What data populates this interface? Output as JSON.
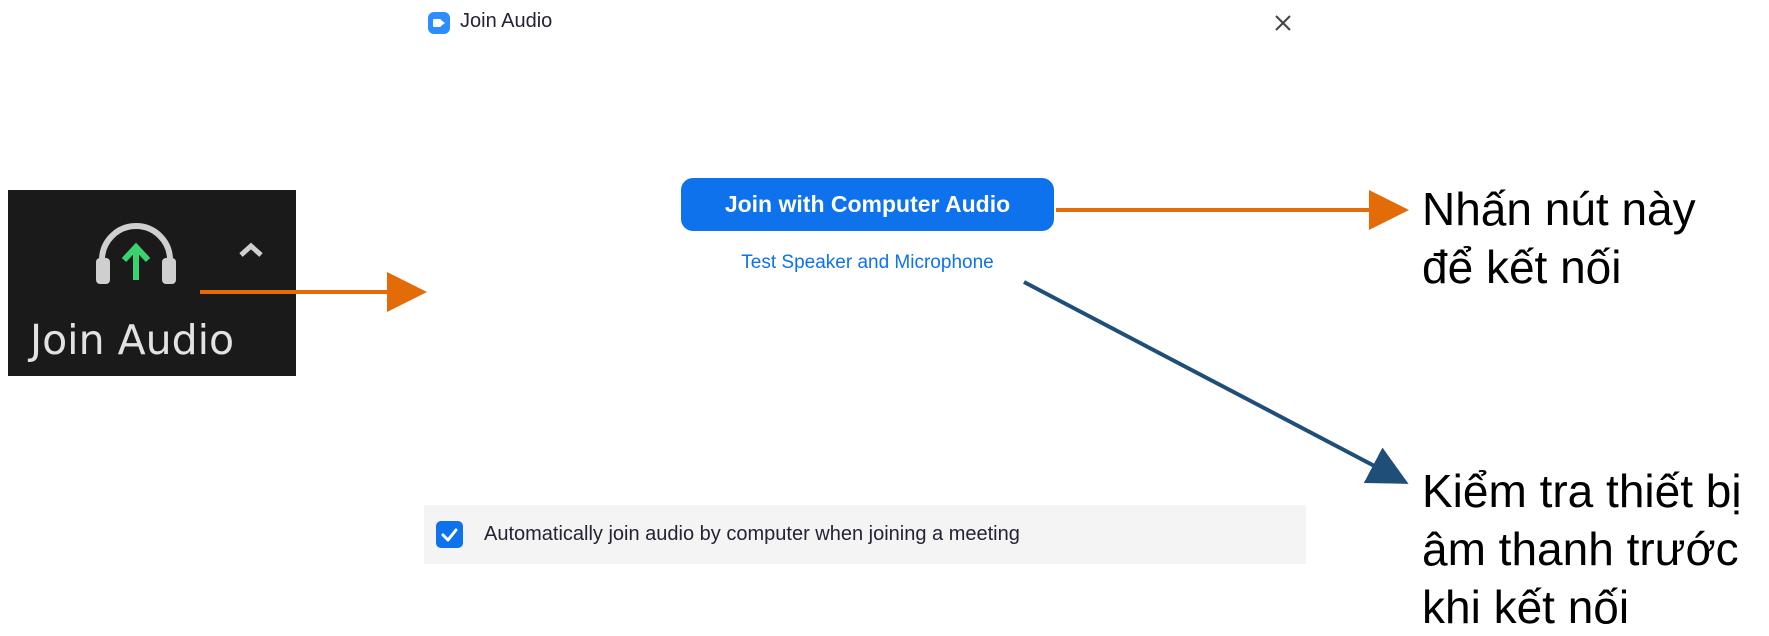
{
  "dialog": {
    "title": "Join Audio",
    "primary_button": "Join with Computer Audio",
    "test_link": "Test Speaker and Microphone",
    "auto_join_label": "Automatically join audio by computer when joining a meeting",
    "auto_join_checked": true
  },
  "toolbar": {
    "label": "Join Audio"
  },
  "annotations": {
    "join_note_line1": "Nhấn nút này",
    "join_note_line2": "để kết nối",
    "test_note_line1": "Kiểm tra thiết bị",
    "test_note_line2": "âm thanh trước",
    "test_note_line3": "khi kết nối"
  },
  "colors": {
    "zoom_blue": "#0e72ed",
    "arrow_orange": "#e36c09",
    "arrow_navy": "#1f4e79",
    "toolbar_bg": "#1a1a1a",
    "headphone_arrow_green": "#3bd16f"
  },
  "icons": [
    "zoom-app-icon",
    "close-icon",
    "checkmark-icon",
    "headphone-icon",
    "up-arrow-icon",
    "caret-up-icon"
  ]
}
